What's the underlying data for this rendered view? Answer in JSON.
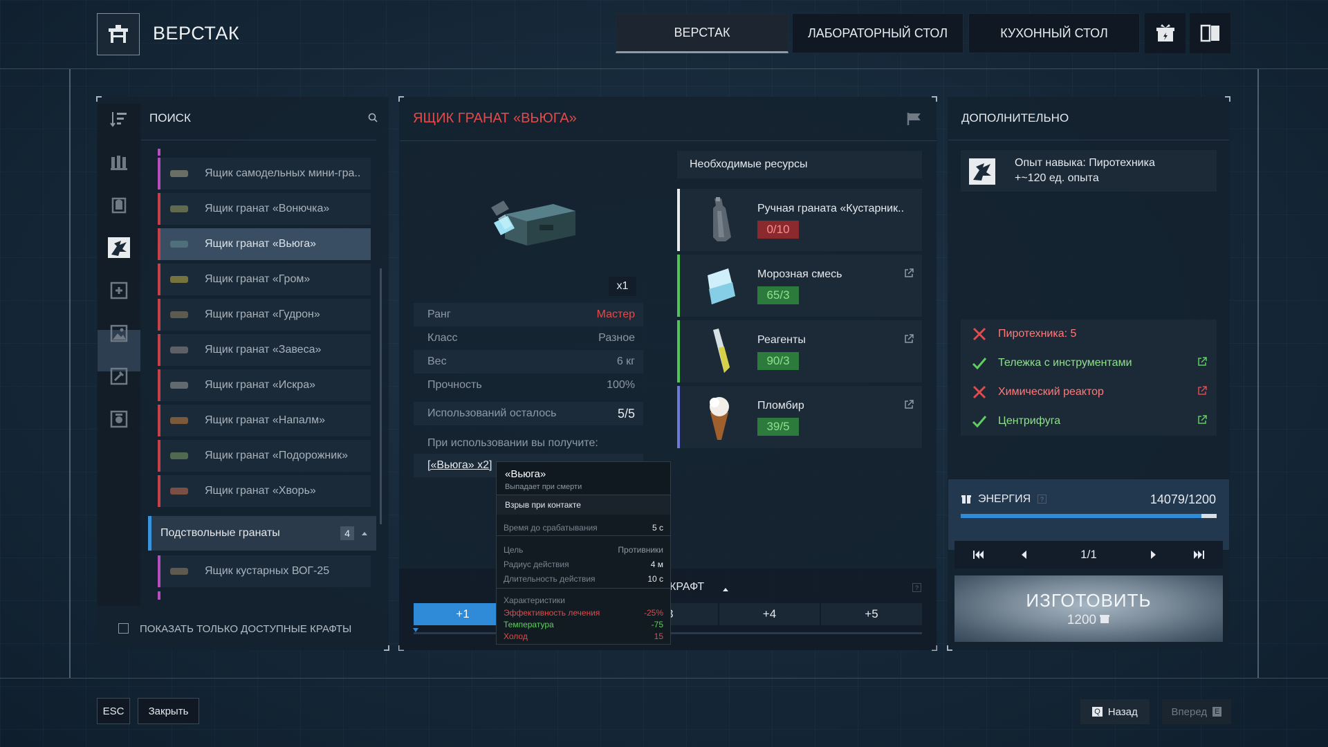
{
  "header": {
    "title": "ВЕРСТАК",
    "tabs": [
      {
        "label": "ВЕРСТАК",
        "active": true
      },
      {
        "label": "ЛАБОРАТОРНЫЙ СТОЛ",
        "active": false
      },
      {
        "label": "КУХОННЫЙ СТОЛ",
        "active": false
      }
    ],
    "extra_icons": [
      "gift-icon",
      "book-icon"
    ]
  },
  "left_panel": {
    "search_label": "ПОИСК",
    "items": [
      {
        "label": "Ящик самодельных мини-гра..",
        "accent": "#b44fbd",
        "thumb": "#6a6f66"
      },
      {
        "label": "Ящик гранат «Вонючка»",
        "accent": "#c64048",
        "thumb": "#5f6a4f"
      },
      {
        "label": "Ящик гранат «Вьюга»",
        "accent": "#c64048",
        "thumb": "#4f6f7a",
        "selected": true
      },
      {
        "label": "Ящик гранат «Гром»",
        "accent": "#c64048",
        "thumb": "#77733f"
      },
      {
        "label": "Ящик гранат «Гудрон»",
        "accent": "#c64048",
        "thumb": "#5d5a50"
      },
      {
        "label": "Ящик гранат «Завеса»",
        "accent": "#c64048",
        "thumb": "#5d6066"
      },
      {
        "label": "Ящик гранат «Искра»",
        "accent": "#c64048",
        "thumb": "#626a70"
      },
      {
        "label": "Ящик гранат «Напалм»",
        "accent": "#c64048",
        "thumb": "#7a5a3a"
      },
      {
        "label": "Ящик гранат «Подорожник»",
        "accent": "#c64048",
        "thumb": "#4f6a4f"
      },
      {
        "label": "Ящик гранат «Хворь»",
        "accent": "#c64048",
        "thumb": "#7a4f44"
      }
    ],
    "subgroup": {
      "label": "Подствольные гранаты",
      "count": "4"
    },
    "subitems": [
      {
        "label": "Ящик кустарных ВОГ-25",
        "accent": "#b44fbd",
        "thumb": "#5e5a50"
      }
    ],
    "filter_label": "ПОКАЗАТЬ ТОЛЬКО ДОСТУПНЫЕ КРАФТЫ"
  },
  "center_panel": {
    "title": "ЯЩИК ГРАНАТ «ВЬЮГА»",
    "quantity": "x1",
    "stats": [
      {
        "key": "Ранг",
        "value": "Мастер",
        "value_color": "#e14b4b"
      },
      {
        "key": "Класс",
        "value": "Разное"
      },
      {
        "key": "Вес",
        "value": "6 кг"
      },
      {
        "key": "Прочность",
        "value": "100%"
      }
    ],
    "uses_left_label": "Использований осталось",
    "uses_left_value": "5/5",
    "on_use_label": "При использовании вы получите:",
    "on_use_item": "[«Вьюга» x2]",
    "resources_header": "Необходимые ресурсы",
    "resources": [
      {
        "name": "Ручная граната «Кустарник..",
        "count": "0/10",
        "ok": false,
        "accent": "#e9ecef",
        "link": false
      },
      {
        "name": "Морозная смесь",
        "count": "65/3",
        "ok": true,
        "accent": "#52c25a",
        "link": true
      },
      {
        "name": "Реагенты",
        "count": "90/3",
        "ok": true,
        "accent": "#52c25a",
        "link": true
      },
      {
        "name": "Пломбир",
        "count": "39/5",
        "ok": true,
        "accent": "#6e78d8",
        "link": true
      }
    ],
    "craft_label": "КРАФТ",
    "craft_steps": [
      "+1",
      "3",
      "+4",
      "+5"
    ]
  },
  "tooltip": {
    "title": "«Вьюга»",
    "subtitle": "Выпадает при смерти",
    "trigger": "Взрыв при контакте",
    "rows": [
      {
        "k": "Время до срабатывания",
        "v": "5 с"
      },
      {
        "k": "Цель",
        "v": "Противники"
      },
      {
        "k": "Радиус действия",
        "v": "4 м"
      },
      {
        "k": "Длительность действия",
        "v": "10 с"
      }
    ],
    "chars_label": "Характеристики",
    "chars": [
      {
        "k": "Эффективность лечения",
        "v": "-25%",
        "color": "#e14b4b"
      },
      {
        "k": "Температура",
        "v": "-75",
        "color": "#5fd05f"
      },
      {
        "k": "Холод",
        "v": "15",
        "color": "#e14b4b"
      }
    ]
  },
  "right_panel": {
    "title": "ДОПОЛНИТЕЛЬНО",
    "skill_line1": "Опыт навыка: Пиротехника",
    "skill_line2": "+~120 ед. опыта",
    "requirements": [
      {
        "label": "Пиротехника: 5",
        "ok": false,
        "link": false
      },
      {
        "label": "Тележка с инструментами",
        "ok": true,
        "link": true
      },
      {
        "label": "Химический реактор",
        "ok": false,
        "link": true
      },
      {
        "label": "Центрифуга",
        "ok": true,
        "link": true
      }
    ],
    "energy_label": "ЭНЕРГИЯ",
    "energy_value": "14079/1200",
    "energy_fraction": 0.94,
    "pager": "1/1",
    "craft_button": "ИЗГОТОВИТЬ",
    "craft_cost": "1200"
  },
  "footer": {
    "esc_key": "ESC",
    "close_label": "Закрыть",
    "back_key": "Q",
    "back_label": "Назад",
    "forward_label": "Вперед",
    "forward_key": "E"
  }
}
